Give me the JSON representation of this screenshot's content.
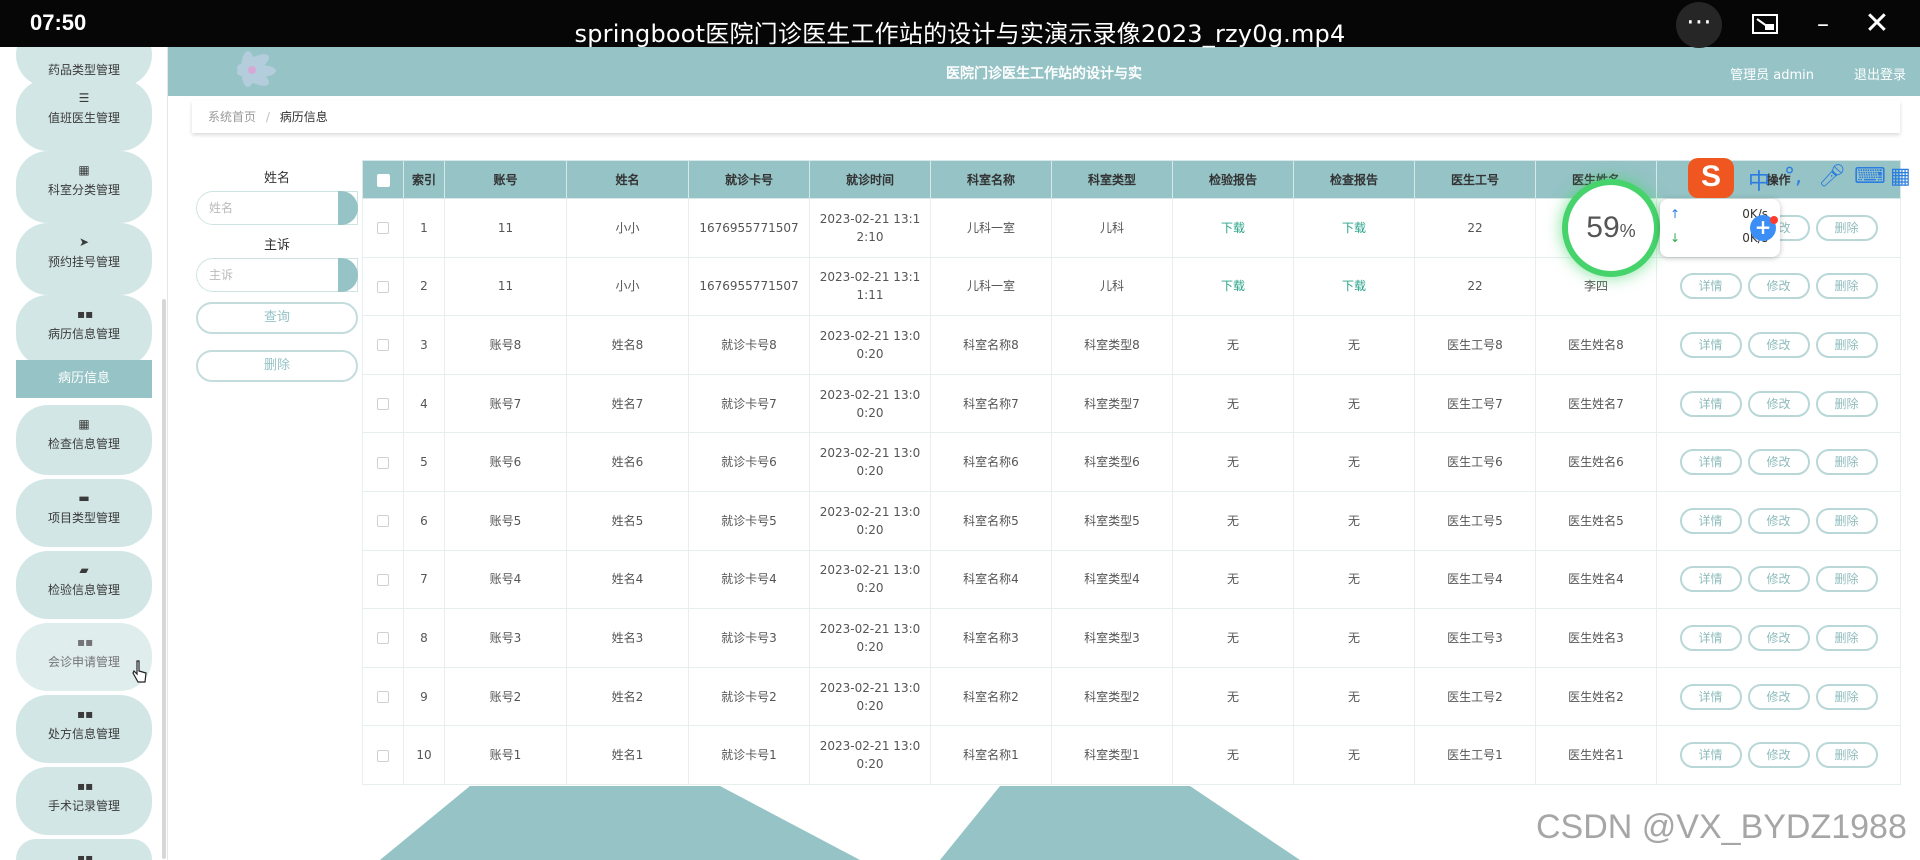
{
  "player": {
    "time": "07:50",
    "title": "springboot医院门诊医生工作站的设计与实演示录像2023_rzy0g.mp4",
    "more_icon": "more-icon",
    "pip_icon": "pip-icon",
    "min_icon": "minimize-icon",
    "close_icon": "close-icon"
  },
  "header": {
    "title": "医院门诊医生工作站的设计与实",
    "user": "管理员 admin",
    "logout": "退出登录"
  },
  "sidebar": {
    "items": [
      {
        "label": "药品类型管理",
        "icon": "grid-icon"
      },
      {
        "label": "值班医生管理",
        "icon": "sliders-icon"
      },
      {
        "label": "科室分类管理",
        "icon": "chart-icon"
      },
      {
        "label": "预约挂号管理",
        "icon": "send-icon"
      },
      {
        "label": "病历信息管理",
        "icon": "grid-icon"
      },
      {
        "label": "检查信息管理",
        "icon": "grid9-icon"
      },
      {
        "label": "项目类型管理",
        "icon": "monitor-icon"
      },
      {
        "label": "检验信息管理",
        "icon": "briefcase-icon"
      },
      {
        "label": "会诊申请管理",
        "icon": "grid-icon"
      },
      {
        "label": "处方信息管理",
        "icon": "grid-icon"
      },
      {
        "label": "手术记录管理",
        "icon": "grid-icon"
      }
    ],
    "active_sub": "病历信息"
  },
  "breadcrumb": {
    "home": "系统首页",
    "sep": "/",
    "current": "病历信息"
  },
  "search": {
    "name_label": "姓名",
    "name_placeholder": "姓名",
    "complaint_label": "主诉",
    "complaint_placeholder": "主诉",
    "query_button": "查询",
    "delete_button": "删除"
  },
  "table": {
    "headers": [
      "索引",
      "账号",
      "姓名",
      "就诊卡号",
      "就诊时间",
      "科室名称",
      "科室类型",
      "检验报告",
      "检查报告",
      "医生工号",
      "医生姓名",
      "操作"
    ],
    "rows": [
      [
        "1",
        "11",
        "小小",
        "1676955771507",
        "2023-02-21 13:12:10",
        "儿科一室",
        "儿科",
        "下载",
        "下载",
        "22",
        "李四"
      ],
      [
        "2",
        "11",
        "小小",
        "1676955771507",
        "2023-02-21 13:11:11",
        "儿科一室",
        "儿科",
        "下载",
        "下载",
        "22",
        "李四"
      ],
      [
        "3",
        "账号8",
        "姓名8",
        "就诊卡号8",
        "2023-02-21 13:00:20",
        "科室名称8",
        "科室类型8",
        "无",
        "无",
        "医生工号8",
        "医生姓名8"
      ],
      [
        "4",
        "账号7",
        "姓名7",
        "就诊卡号7",
        "2023-02-21 13:00:20",
        "科室名称7",
        "科室类型7",
        "无",
        "无",
        "医生工号7",
        "医生姓名7"
      ],
      [
        "5",
        "账号6",
        "姓名6",
        "就诊卡号6",
        "2023-02-21 13:00:20",
        "科室名称6",
        "科室类型6",
        "无",
        "无",
        "医生工号6",
        "医生姓名6"
      ],
      [
        "6",
        "账号5",
        "姓名5",
        "就诊卡号5",
        "2023-02-21 13:00:20",
        "科室名称5",
        "科室类型5",
        "无",
        "无",
        "医生工号5",
        "医生姓名5"
      ],
      [
        "7",
        "账号4",
        "姓名4",
        "就诊卡号4",
        "2023-02-21 13:00:20",
        "科室名称4",
        "科室类型4",
        "无",
        "无",
        "医生工号4",
        "医生姓名4"
      ],
      [
        "8",
        "账号3",
        "姓名3",
        "就诊卡号3",
        "2023-02-21 13:00:20",
        "科室名称3",
        "科室类型3",
        "无",
        "无",
        "医生工号3",
        "医生姓名3"
      ],
      [
        "9",
        "账号2",
        "姓名2",
        "就诊卡号2",
        "2023-02-21 13:00:20",
        "科室名称2",
        "科室类型2",
        "无",
        "无",
        "医生工号2",
        "医生姓名2"
      ],
      [
        "10",
        "账号1",
        "姓名1",
        "就诊卡号1",
        "2023-02-21 13:00:20",
        "科室名称1",
        "科室类型1",
        "无",
        "无",
        "医生工号1",
        "医生姓名1"
      ]
    ],
    "actions": [
      "详情",
      "修改",
      "删除"
    ]
  },
  "speed_widget": {
    "percent": "59",
    "percent_sign": "%",
    "up": "0K/s",
    "down": "0K/s"
  },
  "ime": {
    "logo": "S",
    "mode": "中",
    "punct": "°,"
  },
  "watermark": "CSDN @VX_BYDZ1988",
  "colors": {
    "accent": "#95c3c6",
    "link": "#2aa38a",
    "sidebar_item_bg": "#d3e6e6"
  }
}
